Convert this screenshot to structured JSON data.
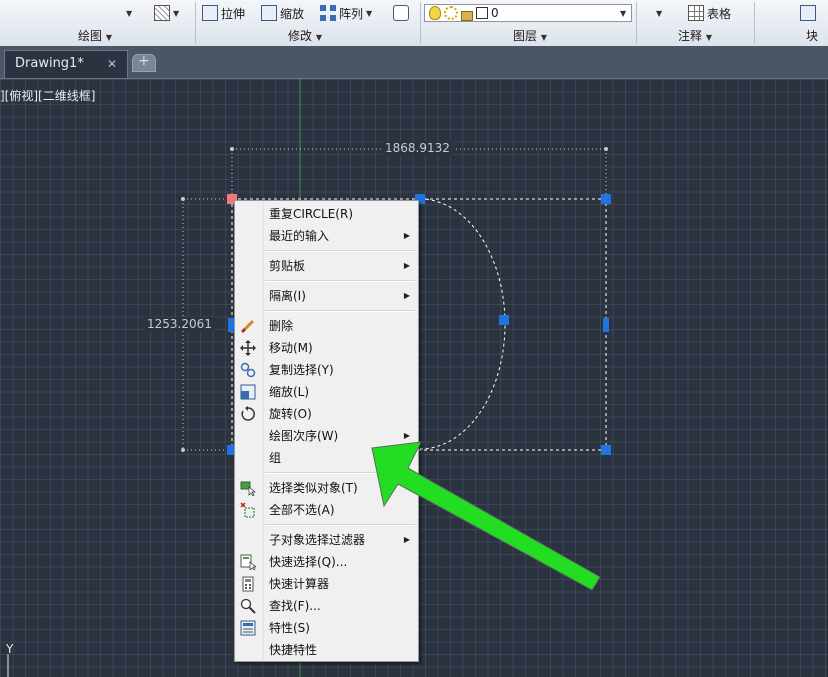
{
  "ribbon": {
    "stretch_label": "拉伸",
    "scale_label": "缩放",
    "array_label": "阵列",
    "layer_value": "0",
    "table_label": "表格",
    "panels": {
      "draw": "绘图",
      "modify": "修改",
      "layers": "图层",
      "annotation": "注释",
      "block": "块"
    }
  },
  "tabs": {
    "drawing": "Drawing1*",
    "close": "✕"
  },
  "viewport": {
    "label": "][俯视][二维线框]"
  },
  "dimensions": {
    "horizontal": "1868.9132",
    "vertical": "1253.2061"
  },
  "ucs_label": "Y",
  "context_menu": {
    "items": [
      {
        "label": "重复CIRCLE(R)",
        "submenu": false
      },
      {
        "label": "最近的输入",
        "submenu": true
      },
      {
        "label": "剪贴板",
        "submenu": true
      },
      {
        "label": "隔离(I)",
        "submenu": true
      },
      {
        "label": "删除",
        "submenu": false,
        "icon": "erase-icon"
      },
      {
        "label": "移动(M)",
        "submenu": false,
        "icon": "move-icon"
      },
      {
        "label": "复制选择(Y)",
        "submenu": false,
        "icon": "copy-icon"
      },
      {
        "label": "缩放(L)",
        "submenu": false,
        "icon": "scale-icon"
      },
      {
        "label": "旋转(O)",
        "submenu": false,
        "icon": "rotate-icon"
      },
      {
        "label": "绘图次序(W)",
        "submenu": true
      },
      {
        "label": "组",
        "submenu": false
      },
      {
        "label": "选择类似对象(T)",
        "submenu": false,
        "icon": "select-similar-icon"
      },
      {
        "label": "全部不选(A)",
        "submenu": false,
        "icon": "deselect-all-icon"
      },
      {
        "label": "子对象选择过滤器",
        "submenu": true
      },
      {
        "label": "快速选择(Q)...",
        "submenu": false,
        "icon": "quick-select-icon"
      },
      {
        "label": "快速计算器",
        "submenu": false,
        "icon": "calculator-icon"
      },
      {
        "label": "查找(F)...",
        "submenu": false,
        "icon": "find-icon"
      },
      {
        "label": "特性(S)",
        "submenu": false,
        "icon": "properties-icon"
      },
      {
        "label": "快捷特性",
        "submenu": false
      }
    ]
  },
  "colors": {
    "canvas": "#2b3340",
    "grip": "#1f74e0",
    "grip_hot": "#f07a7a",
    "arrow": "#22dd22"
  }
}
